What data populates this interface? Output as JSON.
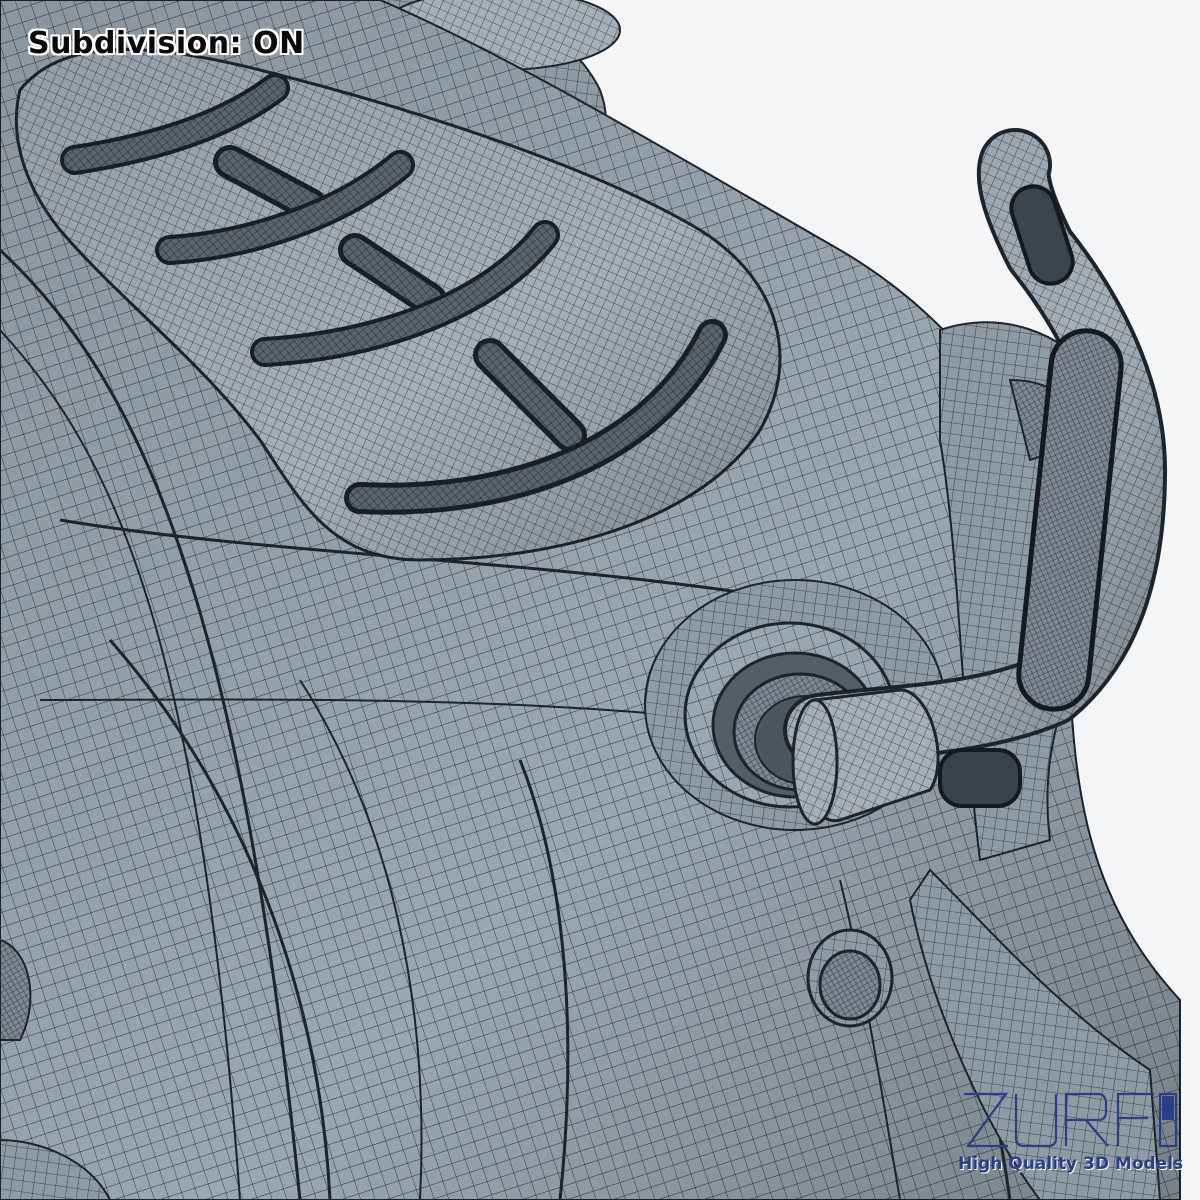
{
  "caption": "Subdivision: ON",
  "watermark": {
    "logo_text": "ZURF",
    "tagline": "High Quality 3D Models"
  },
  "colors": {
    "background": "#f4f5f6",
    "mesh_surface": "#9aa6b0",
    "mesh_shadow": "#6c7882",
    "wire_lines": "#1c242c",
    "slot_dark": "#2a2f35",
    "watermark_blue": "#2a3f86"
  },
  "icons": [
    "mesh-render",
    "zurf-logo-icon"
  ]
}
